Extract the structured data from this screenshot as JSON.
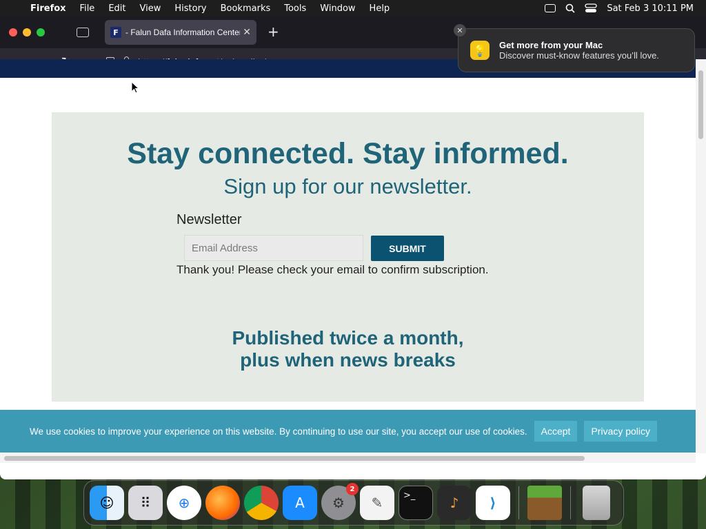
{
  "menubar": {
    "app_name": "Firefox",
    "menus": [
      "File",
      "Edit",
      "View",
      "History",
      "Bookmarks",
      "Tools",
      "Window",
      "Help"
    ],
    "clock": "Sat Feb 3  10:11 PM"
  },
  "browser": {
    "tab_title": "- Falun Dafa Information Center",
    "favicon_letter": "F",
    "url": {
      "protocol": "https://",
      "host": "faluninfo.net",
      "path": "/subscribe/"
    }
  },
  "page": {
    "headline": "Stay connected. Stay informed.",
    "subhead": "Sign up for our newsletter.",
    "newsletter_label": "Newsletter",
    "email_placeholder": "Email Address",
    "submit_label": "SUBMIT",
    "thanks_message": "Thank you! Please check your email to confirm subscription.",
    "published_line1": "Published twice a month,",
    "published_line2": "plus when news breaks"
  },
  "cookie_bar": {
    "text": "We use cookies to improve your experience on this website. By continuing to use our site, you accept our use of cookies.",
    "accept_label": "Accept",
    "privacy_label": "Privacy policy"
  },
  "notification": {
    "title": "Get more from your Mac",
    "body": "Discover must-know features you’ll love."
  },
  "dock": {
    "settings_badge": "2"
  }
}
